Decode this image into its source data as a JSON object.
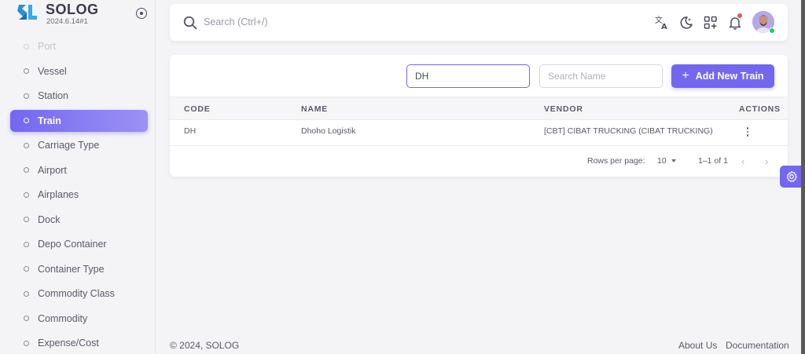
{
  "app": {
    "name": "SOLOG",
    "version": "2024.6.14#1"
  },
  "sidebar": {
    "items": [
      {
        "label": "Port"
      },
      {
        "label": "Vessel"
      },
      {
        "label": "Station"
      },
      {
        "label": "Train"
      },
      {
        "label": "Carriage Type"
      },
      {
        "label": "Airport"
      },
      {
        "label": "Airplanes"
      },
      {
        "label": "Dock"
      },
      {
        "label": "Depo Container"
      },
      {
        "label": "Container Type"
      },
      {
        "label": "Commodity Class"
      },
      {
        "label": "Commodity"
      },
      {
        "label": "Expense/Cost"
      }
    ],
    "active_item": "Train"
  },
  "navbar": {
    "search_placeholder": "Search (Ctrl+/)",
    "icons": [
      "translate-icon",
      "moon-icon",
      "apps-add-icon",
      "bell-icon"
    ]
  },
  "filters": {
    "code_value": "DH",
    "name_placeholder": "Search Name"
  },
  "actions": {
    "add_label": "Add New Train"
  },
  "table": {
    "headers": {
      "code": "CODE",
      "name": "NAME",
      "vendor": "VENDOR",
      "actions": "ACTIONS"
    },
    "rows": [
      {
        "code": "DH",
        "name": "Dhoho Logistik",
        "vendor": "[CBT] CIBAT TRUCKING (CIBAT TRUCKING)"
      }
    ]
  },
  "pagination": {
    "rows_per_page_label": "Rows per page:",
    "rows_per_page_value": "10",
    "range": "1–1 of 1"
  },
  "footer": {
    "copyright": "© 2024, SOLOG",
    "about": "About Us",
    "docs": "Documentation"
  },
  "colors": {
    "accent": "#7367f0",
    "notification": "#ea5455",
    "online": "#28c76f"
  }
}
